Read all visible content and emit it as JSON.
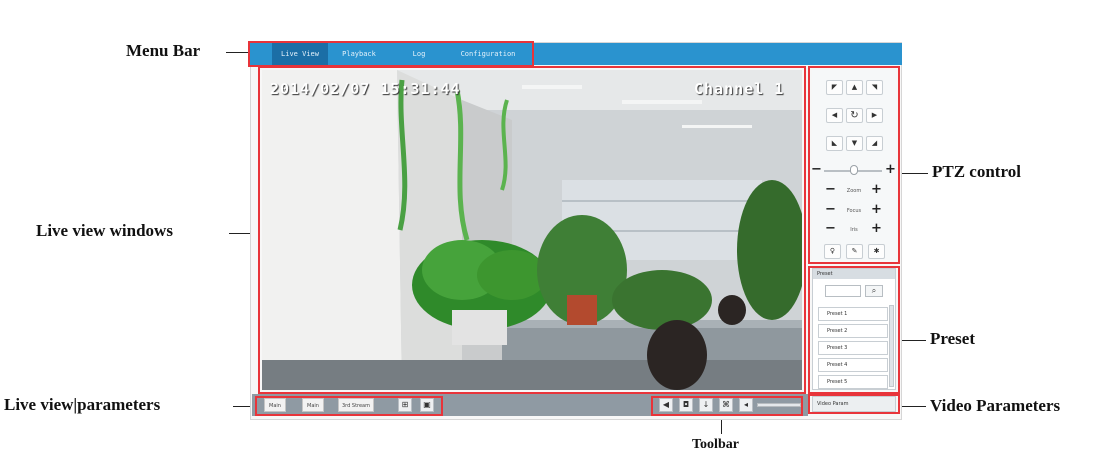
{
  "callouts": {
    "menu_bar": "Menu Bar",
    "live_view_windows": "Live view windows",
    "live_view_parameters": "Live view|parameters",
    "toolbar": "Toolbar",
    "ptz_control": "PTZ control",
    "preset": "Preset",
    "video_parameters": "Video Parameters"
  },
  "menu": {
    "items": [
      "Live View",
      "Playback",
      "Log",
      "Configuration"
    ],
    "active_index": 0
  },
  "live_view": {
    "timestamp": "2014/02/07 15:31:44",
    "channel": "Channel 1"
  },
  "stream_tabs": [
    "Main",
    "Main",
    "3rd Stream"
  ],
  "icons": {
    "window_layout": "window-layout-icon",
    "fullscreen": "fullscreen-icon",
    "stop": "stop-live-icon",
    "capture": "capture-icon",
    "record": "record-icon",
    "zoom": "digital-zoom-icon",
    "volume": "volume-icon"
  },
  "ptz": {
    "labels": {
      "zoom": "Zoom",
      "focus": "Focus",
      "iris": "Iris"
    },
    "minus": "−",
    "plus": "+"
  },
  "preset_panel": {
    "title": "Preset",
    "items": [
      "Preset 1",
      "Preset 2",
      "Preset 3",
      "Preset 4",
      "Preset 5"
    ]
  },
  "video_parameters_panel": {
    "title": "Video Param"
  },
  "colors": {
    "accent": "#2a93cf",
    "callout_box": "#e8343a"
  }
}
